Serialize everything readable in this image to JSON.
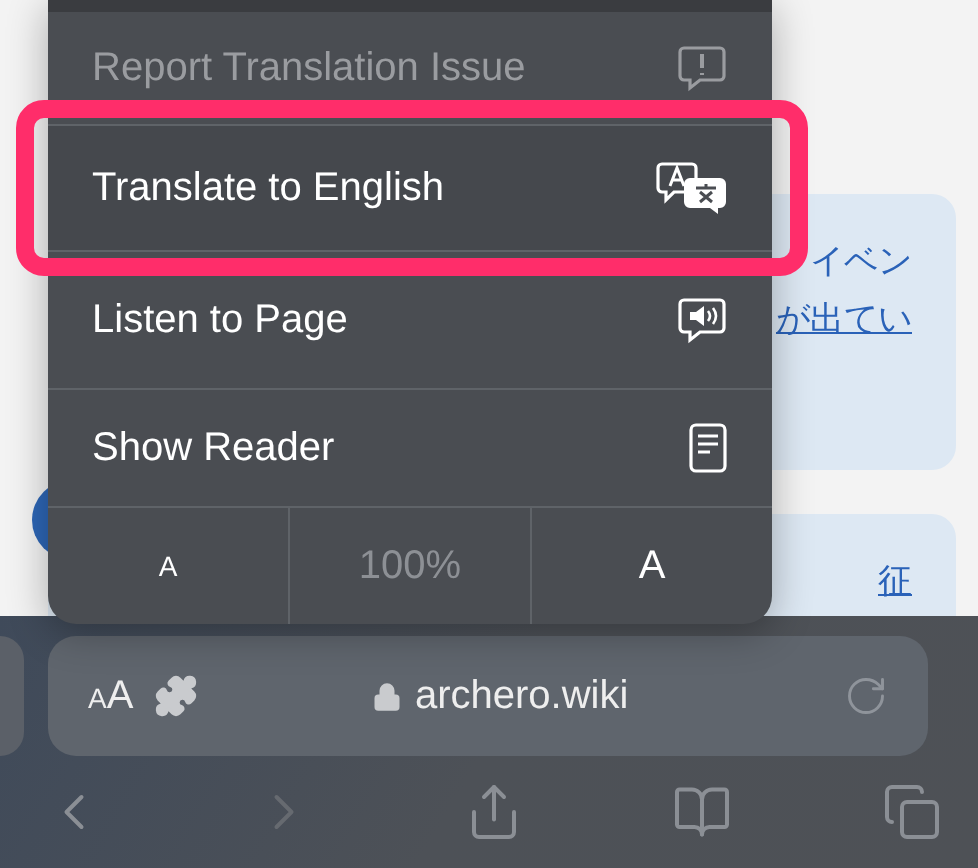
{
  "page": {
    "cards": [
      {
        "lines": [
          {
            "text": "イベン",
            "link": false
          },
          {
            "text": "が出てい",
            "link": true
          }
        ]
      },
      {
        "lines": [
          {
            "text": "征",
            "link": true
          }
        ]
      }
    ]
  },
  "menu": {
    "items": [
      {
        "label": "Report Translation Issue",
        "kind": "report",
        "disabled": true,
        "highlighted": false
      },
      {
        "label": "Translate to English",
        "kind": "translate",
        "disabled": false,
        "highlighted": true
      },
      {
        "label": "Listen to Page",
        "kind": "listen",
        "disabled": false,
        "highlighted": false
      },
      {
        "label": "Show Reader",
        "kind": "reader",
        "disabled": false,
        "highlighted": false
      }
    ],
    "zoom": {
      "smaller": "A",
      "level": "100%",
      "larger": "A"
    }
  },
  "address_bar": {
    "format_small": "A",
    "format_large": "A",
    "url": "archero.wiki"
  },
  "toolbar": [
    {
      "kind": "back",
      "disabled": false
    },
    {
      "kind": "forward",
      "disabled": true
    },
    {
      "kind": "share",
      "disabled": false
    },
    {
      "kind": "bookmarks",
      "disabled": false
    },
    {
      "kind": "tabs",
      "disabled": false
    }
  ]
}
